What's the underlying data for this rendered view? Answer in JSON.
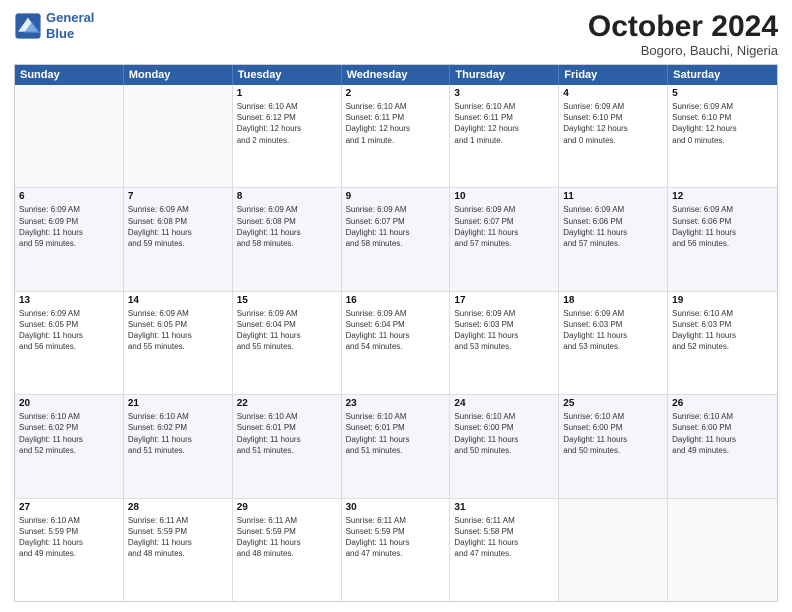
{
  "logo": {
    "line1": "General",
    "line2": "Blue"
  },
  "title": "October 2024",
  "location": "Bogoro, Bauchi, Nigeria",
  "headers": [
    "Sunday",
    "Monday",
    "Tuesday",
    "Wednesday",
    "Thursday",
    "Friday",
    "Saturday"
  ],
  "rows": [
    [
      {
        "day": "",
        "info": ""
      },
      {
        "day": "",
        "info": ""
      },
      {
        "day": "1",
        "info": "Sunrise: 6:10 AM\nSunset: 6:12 PM\nDaylight: 12 hours\nand 2 minutes."
      },
      {
        "day": "2",
        "info": "Sunrise: 6:10 AM\nSunset: 6:11 PM\nDaylight: 12 hours\nand 1 minute."
      },
      {
        "day": "3",
        "info": "Sunrise: 6:10 AM\nSunset: 6:11 PM\nDaylight: 12 hours\nand 1 minute."
      },
      {
        "day": "4",
        "info": "Sunrise: 6:09 AM\nSunset: 6:10 PM\nDaylight: 12 hours\nand 0 minutes."
      },
      {
        "day": "5",
        "info": "Sunrise: 6:09 AM\nSunset: 6:10 PM\nDaylight: 12 hours\nand 0 minutes."
      }
    ],
    [
      {
        "day": "6",
        "info": "Sunrise: 6:09 AM\nSunset: 6:09 PM\nDaylight: 11 hours\nand 59 minutes."
      },
      {
        "day": "7",
        "info": "Sunrise: 6:09 AM\nSunset: 6:08 PM\nDaylight: 11 hours\nand 59 minutes."
      },
      {
        "day": "8",
        "info": "Sunrise: 6:09 AM\nSunset: 6:08 PM\nDaylight: 11 hours\nand 58 minutes."
      },
      {
        "day": "9",
        "info": "Sunrise: 6:09 AM\nSunset: 6:07 PM\nDaylight: 11 hours\nand 58 minutes."
      },
      {
        "day": "10",
        "info": "Sunrise: 6:09 AM\nSunset: 6:07 PM\nDaylight: 11 hours\nand 57 minutes."
      },
      {
        "day": "11",
        "info": "Sunrise: 6:09 AM\nSunset: 6:06 PM\nDaylight: 11 hours\nand 57 minutes."
      },
      {
        "day": "12",
        "info": "Sunrise: 6:09 AM\nSunset: 6:06 PM\nDaylight: 11 hours\nand 56 minutes."
      }
    ],
    [
      {
        "day": "13",
        "info": "Sunrise: 6:09 AM\nSunset: 6:05 PM\nDaylight: 11 hours\nand 56 minutes."
      },
      {
        "day": "14",
        "info": "Sunrise: 6:09 AM\nSunset: 6:05 PM\nDaylight: 11 hours\nand 55 minutes."
      },
      {
        "day": "15",
        "info": "Sunrise: 6:09 AM\nSunset: 6:04 PM\nDaylight: 11 hours\nand 55 minutes."
      },
      {
        "day": "16",
        "info": "Sunrise: 6:09 AM\nSunset: 6:04 PM\nDaylight: 11 hours\nand 54 minutes."
      },
      {
        "day": "17",
        "info": "Sunrise: 6:09 AM\nSunset: 6:03 PM\nDaylight: 11 hours\nand 53 minutes."
      },
      {
        "day": "18",
        "info": "Sunrise: 6:09 AM\nSunset: 6:03 PM\nDaylight: 11 hours\nand 53 minutes."
      },
      {
        "day": "19",
        "info": "Sunrise: 6:10 AM\nSunset: 6:03 PM\nDaylight: 11 hours\nand 52 minutes."
      }
    ],
    [
      {
        "day": "20",
        "info": "Sunrise: 6:10 AM\nSunset: 6:02 PM\nDaylight: 11 hours\nand 52 minutes."
      },
      {
        "day": "21",
        "info": "Sunrise: 6:10 AM\nSunset: 6:02 PM\nDaylight: 11 hours\nand 51 minutes."
      },
      {
        "day": "22",
        "info": "Sunrise: 6:10 AM\nSunset: 6:01 PM\nDaylight: 11 hours\nand 51 minutes."
      },
      {
        "day": "23",
        "info": "Sunrise: 6:10 AM\nSunset: 6:01 PM\nDaylight: 11 hours\nand 51 minutes."
      },
      {
        "day": "24",
        "info": "Sunrise: 6:10 AM\nSunset: 6:00 PM\nDaylight: 11 hours\nand 50 minutes."
      },
      {
        "day": "25",
        "info": "Sunrise: 6:10 AM\nSunset: 6:00 PM\nDaylight: 11 hours\nand 50 minutes."
      },
      {
        "day": "26",
        "info": "Sunrise: 6:10 AM\nSunset: 6:00 PM\nDaylight: 11 hours\nand 49 minutes."
      }
    ],
    [
      {
        "day": "27",
        "info": "Sunrise: 6:10 AM\nSunset: 5:59 PM\nDaylight: 11 hours\nand 49 minutes."
      },
      {
        "day": "28",
        "info": "Sunrise: 6:11 AM\nSunset: 5:59 PM\nDaylight: 11 hours\nand 48 minutes."
      },
      {
        "day": "29",
        "info": "Sunrise: 6:11 AM\nSunset: 5:59 PM\nDaylight: 11 hours\nand 48 minutes."
      },
      {
        "day": "30",
        "info": "Sunrise: 6:11 AM\nSunset: 5:59 PM\nDaylight: 11 hours\nand 47 minutes."
      },
      {
        "day": "31",
        "info": "Sunrise: 6:11 AM\nSunset: 5:58 PM\nDaylight: 11 hours\nand 47 minutes."
      },
      {
        "day": "",
        "info": ""
      },
      {
        "day": "",
        "info": ""
      }
    ]
  ]
}
